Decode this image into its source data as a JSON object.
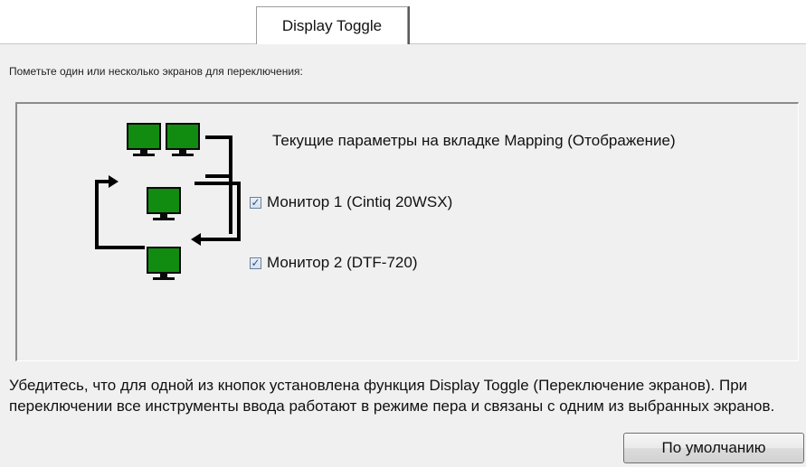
{
  "tab": {
    "label": "Display Toggle"
  },
  "instruction": "Пометьте один или несколько экранов для переключения:",
  "panel": {
    "current_mapping_label": "Текущие параметры на вкладке Mapping (Отображение)",
    "monitors": [
      {
        "label": "Монитор 1 (Cintiq 20WSX)",
        "checked": true
      },
      {
        "label": "Монитор 2 (DTF-720)",
        "checked": true
      }
    ]
  },
  "note": "Убедитесь, что для одной из кнопок установлена функция Display Toggle (Переключение экранов). При переключении все инструменты ввода работают в режиме пера и связаны с одним из выбранных экранов.",
  "buttons": {
    "default": "По умолчанию"
  },
  "colors": {
    "monitor_screen": "#118c11",
    "checkbox_mark": "#2a4f8c"
  }
}
